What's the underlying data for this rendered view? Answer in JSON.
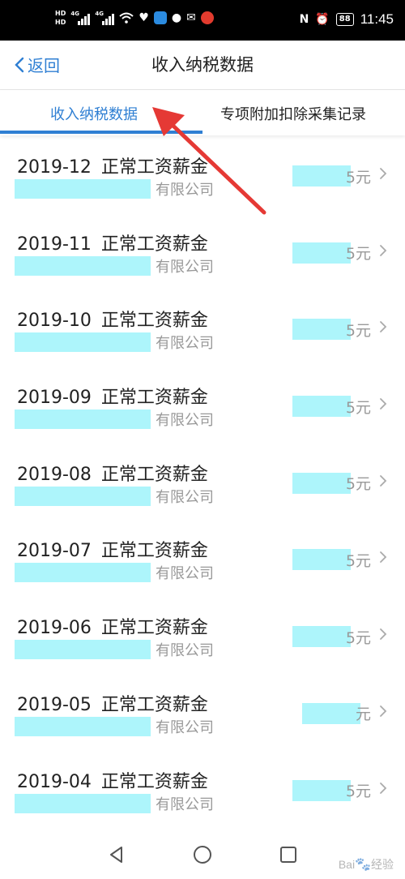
{
  "status_bar": {
    "hd_labels": [
      "HD",
      "HD"
    ],
    "net_labels": [
      "4G",
      "4G"
    ],
    "battery": "88",
    "time": "11:45",
    "icons": [
      "wifi-icon",
      "heart-rate-icon",
      "app-badge-icon",
      "chat-icon",
      "mail-icon",
      "red-app-icon",
      "nfc-icon",
      "alarm-icon",
      "battery-icon"
    ]
  },
  "header": {
    "back_label": "返回",
    "title": "收入纳税数据"
  },
  "tabs": {
    "active": "收入纳税数据",
    "other": "专项附加扣除采集记录"
  },
  "records": [
    {
      "month": "2019-12",
      "type": "正常工资薪金",
      "company_suffix": "有限公司",
      "amount_suffix": "5元"
    },
    {
      "month": "2019-11",
      "type": "正常工资薪金",
      "company_suffix": "有限公司",
      "amount_suffix": "5元"
    },
    {
      "month": "2019-10",
      "type": "正常工资薪金",
      "company_suffix": "有限公司",
      "amount_suffix": "5元"
    },
    {
      "month": "2019-09",
      "type": "正常工资薪金",
      "company_suffix": "有限公司",
      "amount_suffix": "5元"
    },
    {
      "month": "2019-08",
      "type": "正常工资薪金",
      "company_suffix": "有限公司",
      "amount_suffix": "5元"
    },
    {
      "month": "2019-07",
      "type": "正常工资薪金",
      "company_suffix": "有限公司",
      "amount_suffix": "5元"
    },
    {
      "month": "2019-06",
      "type": "正常工资薪金",
      "company_suffix": "有限公司",
      "amount_suffix": "5元"
    },
    {
      "month": "2019-05",
      "type": "正常工资薪金",
      "company_suffix": "有限公司",
      "amount_suffix": "元"
    },
    {
      "month": "2019-04",
      "type": "正常工资薪金",
      "company_suffix": "有限公司",
      "amount_suffix": "5元"
    }
  ],
  "watermark": "Baidu 经验\njingyan.baidu.com",
  "colors": {
    "accent": "#2f7fd3",
    "redaction": "#adf5fb",
    "annotation_arrow": "#e53935"
  }
}
